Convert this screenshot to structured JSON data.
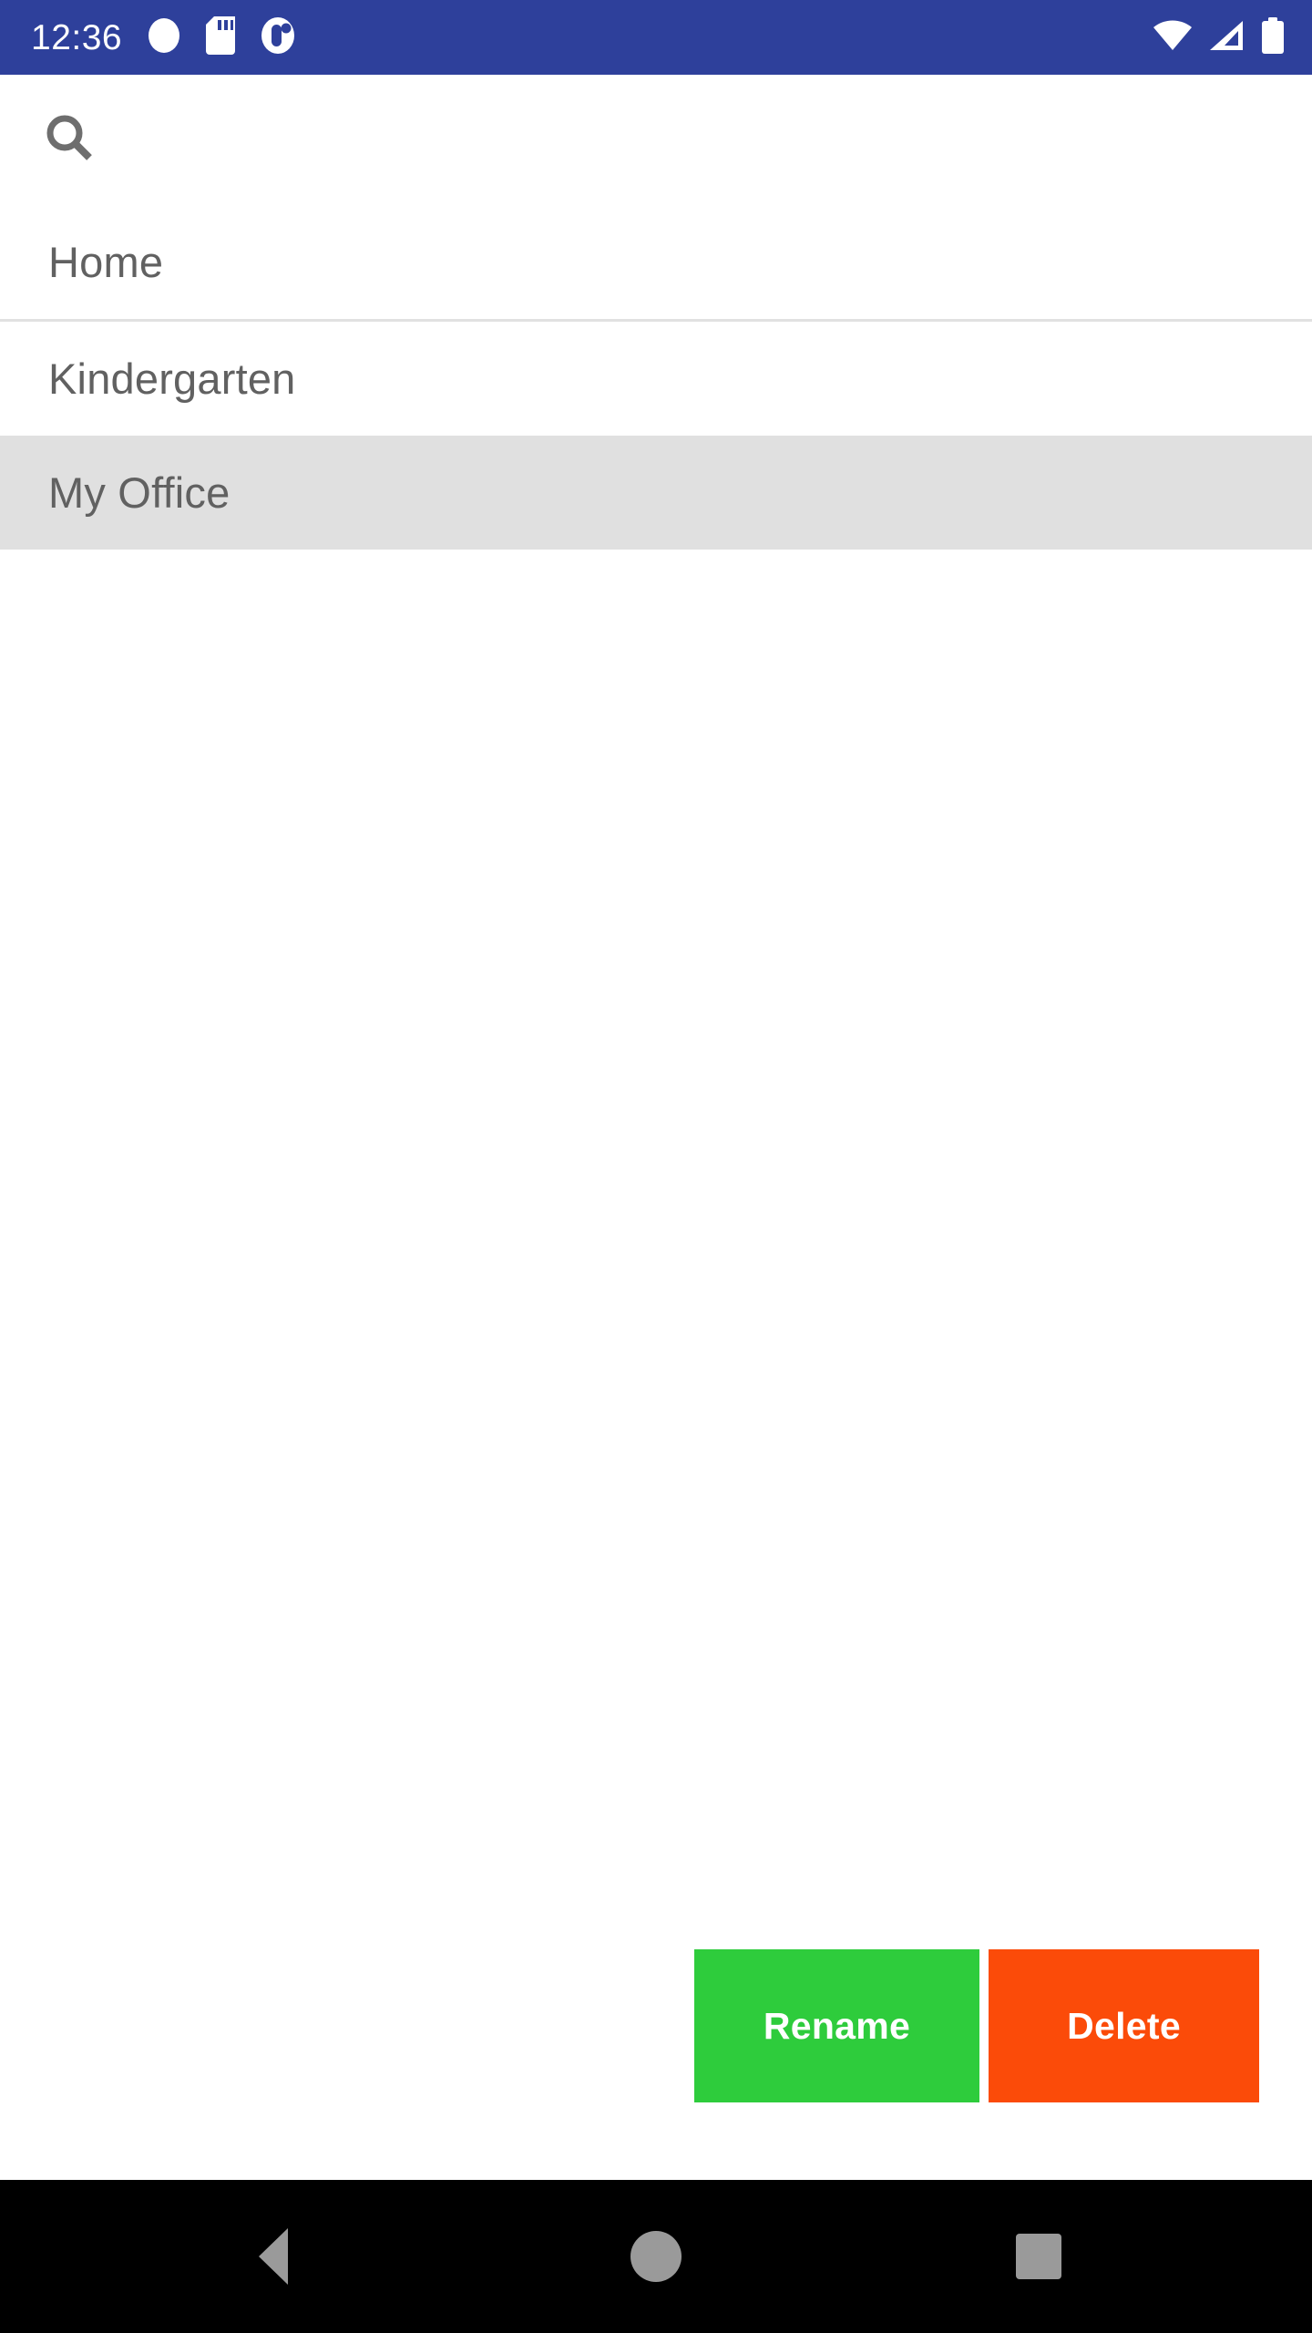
{
  "status_bar": {
    "time": "12:36",
    "background_color": "#2e409b",
    "foreground_color": "#ffffff",
    "left_icons": [
      {
        "name": "circle-indicator-icon"
      },
      {
        "name": "sd-card-icon"
      },
      {
        "name": "notification-badge-icon"
      }
    ],
    "right_icons": [
      {
        "name": "wifi-icon",
        "state": "full"
      },
      {
        "name": "cellular-signal-icon",
        "state": "partial"
      },
      {
        "name": "battery-icon",
        "state": "full"
      }
    ]
  },
  "search": {
    "icon": "search-icon",
    "value": "",
    "placeholder": ""
  },
  "list": {
    "items": [
      {
        "label": "Home",
        "selected": false
      },
      {
        "label": "Kindergarten",
        "selected": false
      },
      {
        "label": "My Office",
        "selected": true
      }
    ],
    "selected_background": "#e0e0e0",
    "divider_color": "#e1e1e1",
    "text_color": "#616161"
  },
  "actions": {
    "rename_label": "Rename",
    "rename_color": "#2ecc3c",
    "delete_label": "Delete",
    "delete_color": "#fb4b09"
  },
  "nav_bar": {
    "background_color": "#000000",
    "icon_color": "#9a9a9a",
    "buttons": [
      {
        "name": "back-button"
      },
      {
        "name": "home-button"
      },
      {
        "name": "recents-button"
      }
    ]
  }
}
